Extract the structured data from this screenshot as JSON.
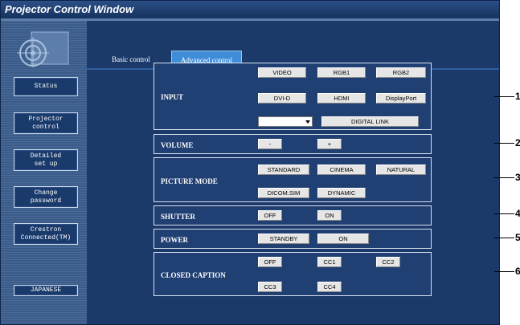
{
  "window": {
    "title": "Projector Control Window"
  },
  "sidebar": {
    "buttons": [
      {
        "label": "Status"
      },
      {
        "label": "Projector\ncontrol"
      },
      {
        "label": "Detailed\nset up"
      },
      {
        "label": "Change\npassword"
      },
      {
        "label": "Crestron\nConnected(TM)"
      }
    ],
    "language_button": "JAPANESE"
  },
  "tabs": {
    "basic": "Basic control",
    "advanced": "Advanced control"
  },
  "sections": {
    "input": {
      "label": "INPUT",
      "buttons": [
        "VIDEO",
        "RGB1",
        "RGB2",
        "DVI-D",
        "HDMI",
        "DisplayPort"
      ],
      "select_value": "",
      "digital_link": "DIGITAL LINK"
    },
    "volume": {
      "label": "VOLUME",
      "minus": "-",
      "plus": "+"
    },
    "picture_mode": {
      "label": "PICTURE MODE",
      "buttons": [
        "STANDARD",
        "CINEMA",
        "NATURAL",
        "DICOM.SIM",
        "DYNAMIC"
      ]
    },
    "shutter": {
      "label": "SHUTTER",
      "off": "OFF",
      "on": "ON"
    },
    "power": {
      "label": "POWER",
      "standby": "STANDBY",
      "on": "ON"
    },
    "closed_caption": {
      "label": "CLOSED CAPTION",
      "buttons": [
        "OFF",
        "CC1",
        "CC2",
        "CC3",
        "CC4"
      ]
    }
  },
  "callouts": [
    "1",
    "2",
    "3",
    "4",
    "5",
    "6"
  ]
}
